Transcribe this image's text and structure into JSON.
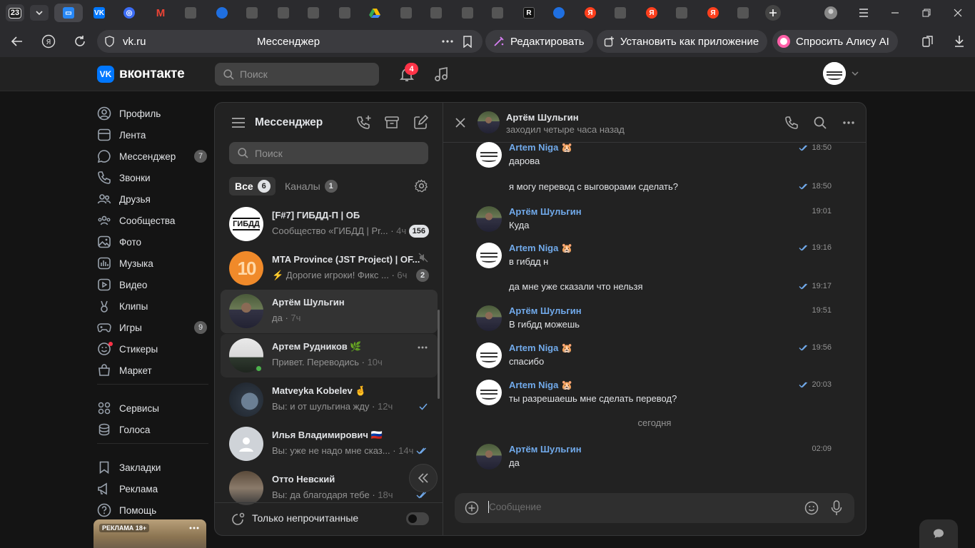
{
  "browser": {
    "tab_count": "23",
    "url_domain": "vk.ru",
    "page_title": "Мессенджер",
    "edit_label": "Редактировать",
    "install_label": "Установить как приложение",
    "alice_label": "Спросить Алису AI"
  },
  "vk": {
    "logo_text": "вконтакте",
    "search_placeholder": "Поиск",
    "notifications_count": "4"
  },
  "nav": {
    "items": [
      {
        "label": "Профиль",
        "icon": "profile-icon"
      },
      {
        "label": "Лента",
        "icon": "feed-icon"
      },
      {
        "label": "Мессенджер",
        "icon": "messenger-icon",
        "count": "7"
      },
      {
        "label": "Звонки",
        "icon": "phone-icon"
      },
      {
        "label": "Друзья",
        "icon": "friends-icon"
      },
      {
        "label": "Сообщества",
        "icon": "communities-icon"
      },
      {
        "label": "Фото",
        "icon": "photo-icon"
      },
      {
        "label": "Музыка",
        "icon": "music-icon"
      },
      {
        "label": "Видео",
        "icon": "video-icon"
      },
      {
        "label": "Клипы",
        "icon": "clips-icon"
      },
      {
        "label": "Игры",
        "icon": "games-icon",
        "count": "9"
      },
      {
        "label": "Стикеры",
        "icon": "stickers-icon"
      },
      {
        "label": "Маркет",
        "icon": "market-icon"
      },
      {
        "label": "Сервисы",
        "icon": "services-icon"
      },
      {
        "label": "Голоса",
        "icon": "votes-icon"
      },
      {
        "label": "Закладки",
        "icon": "bookmark-icon"
      },
      {
        "label": "Реклама",
        "icon": "ads-icon"
      },
      {
        "label": "Помощь",
        "icon": "help-icon"
      }
    ],
    "ad_label": "РЕКЛАМА 18+"
  },
  "messenger": {
    "title": "Мессенджер",
    "search_placeholder": "Поиск",
    "filter_all": "Все",
    "filter_all_count": "6",
    "filter_channels": "Каналы",
    "filter_channels_count": "1",
    "only_unread": "Только непрочитанные",
    "conversations": [
      {
        "name": "[F#7] ГИБДД-П | ОБ",
        "preview": "Сообщество «ГИБДД | Pr...",
        "time": "4ч",
        "unread": "156"
      },
      {
        "name": "MTA Province (JST Project) | OF...",
        "preview": "⚡ Дорогие игроки! Фикс ...",
        "time": "6ч",
        "unread": "2"
      },
      {
        "name": "Артём Шульгин",
        "preview": "да",
        "time": "7ч"
      },
      {
        "name": "Артем Рудников 🌿",
        "preview": "Привет. Переводись",
        "time": "10ч"
      },
      {
        "name": "Matveyka Kobelev 🤞",
        "preview": "Вы: и от шульгина жду",
        "time": "12ч"
      },
      {
        "name": "Илья Владимирович 🇷🇺",
        "preview": "Вы: уже не надо мне сказ...",
        "time": "14ч"
      },
      {
        "name": "Отто Невский",
        "preview": "Вы: да благодаря тебе",
        "time": "18ч"
      }
    ]
  },
  "chat": {
    "name": "Артём Шульгин",
    "status": "заходил четыре часа назад",
    "day_separator": "сегодня",
    "composer_placeholder": "Сообщение",
    "messages": [
      {
        "author": "Artem Niga 🐹",
        "text": "дарова",
        "time": "18:50",
        "read": true
      },
      {
        "author": "",
        "text": "я могу перевод с выговорами сделать?",
        "time": "18:50",
        "read": true
      },
      {
        "author": "Артём Шульгин",
        "text": "Куда",
        "time": "19:01"
      },
      {
        "author": "Artem Niga 🐹",
        "text": "в гибдд н",
        "time": "19:16",
        "read": true
      },
      {
        "author": "",
        "text": "да мне уже сказали что нельзя",
        "time": "19:17",
        "read": true
      },
      {
        "author": "Артём Шульгин",
        "text": "В гибдд можешь",
        "time": "19:51"
      },
      {
        "author": "Artem Niga 🐹",
        "text": "спасибо",
        "time": "19:56",
        "read": true
      },
      {
        "author": "Artem Niga 🐹",
        "text": "ты разрешаешь мне сделать перевод?",
        "time": "20:03",
        "read": true
      },
      {
        "author": "Артём Шульгин",
        "text": "да",
        "time": "02:09"
      }
    ]
  },
  "colors": {
    "accent": "#0077ff",
    "link": "#71aaeb",
    "badge_red": "#ff3347",
    "online": "#4bb34b"
  }
}
